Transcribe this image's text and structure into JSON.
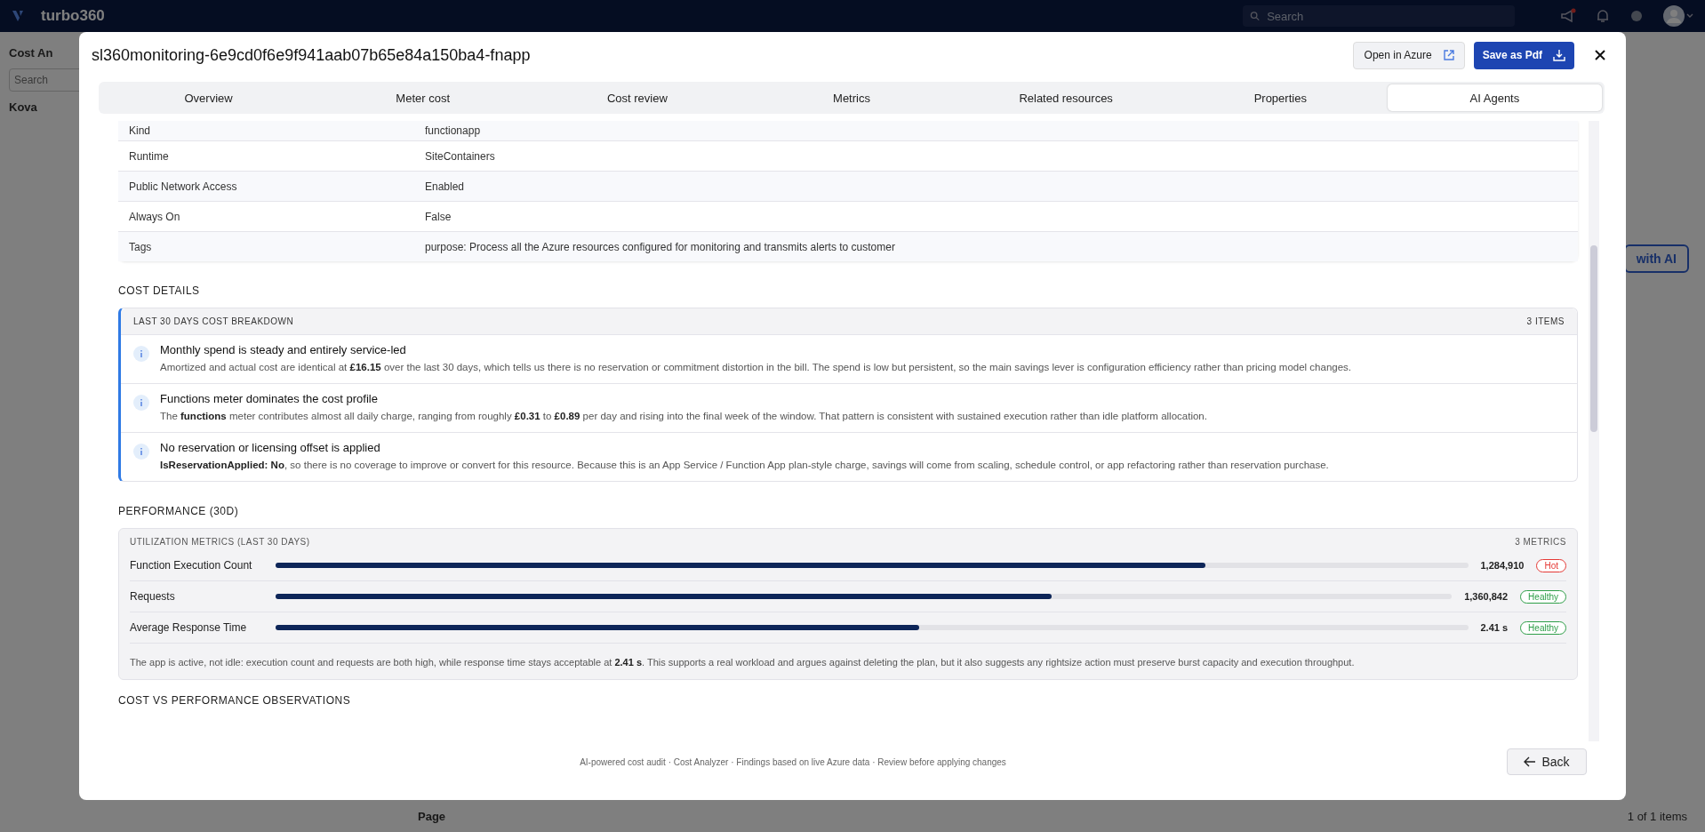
{
  "app": {
    "brand": "turbo360",
    "search": {
      "placeholder": "Search"
    },
    "page_title": "Cost An",
    "filter": {
      "placeholder": "Search"
    },
    "tree_item": "Kova",
    "ai_button": "with AI",
    "pager_label": "Page",
    "pager_count": "1 of 1 items"
  },
  "dialog": {
    "title": "sl360monitoring-6e9cd0f6e9f941aab07b65e84a150ba4-fnapp",
    "open_button": "Open in Azure",
    "pdf_button": "Save as Pdf",
    "tabs": [
      {
        "label": "Overview",
        "selected": false
      },
      {
        "label": "Meter cost",
        "selected": false
      },
      {
        "label": "Cost review",
        "selected": false
      },
      {
        "label": "Metrics",
        "selected": false
      },
      {
        "label": "Related resources",
        "selected": false
      },
      {
        "label": "Properties",
        "selected": false
      },
      {
        "label": "AI Agents",
        "selected": true
      }
    ],
    "properties": [
      {
        "name": "Kind",
        "value": "functionapp"
      },
      {
        "name": "Runtime",
        "value": "SiteContainers"
      },
      {
        "name": "Public Network Access",
        "value": "Enabled"
      },
      {
        "name": "Always On",
        "value": "False"
      },
      {
        "name": "Tags",
        "value": "purpose: Process all the Azure resources configured for monitoring and transmits alerts to customer"
      }
    ],
    "cost_details": {
      "heading": "COST DETAILS",
      "card_title": "LAST 30 DAYS COST BREAKDOWN",
      "count": "3 ITEMS",
      "items": [
        {
          "title": "Monthly spend is steady and entirely service-led",
          "text": "Amortized and actual cost are identical at **£16.15** over the last 30 days, which tells us there is no reservation or commitment distortion in the bill. The spend is low but persistent, so the main savings lever is configuration efficiency rather than pricing model changes."
        },
        {
          "title": "Functions meter dominates the cost profile",
          "text": "The **functions** meter contributes almost all daily charge, ranging from roughly **£0.31** to **£0.89** per day and rising into the final week of the window. That pattern is consistent with sustained execution rather than idle platform allocation."
        },
        {
          "title": "No reservation or licensing offset is applied",
          "text": "**IsReservationApplied: No**, so there is no coverage to improve or convert for this resource. Because this is an App Service / Function App plan-style charge, savings will come from scaling, schedule control, or app refactoring rather than reservation purchase."
        }
      ]
    },
    "performance": {
      "heading": "PERFORMANCE (30D)",
      "card_title": "UTILIZATION METRICS (LAST 30 DAYS)",
      "count": "3 METRICS",
      "metrics": [
        {
          "name": "Function Execution Count",
          "level": 0.78,
          "reading": "1,284,910",
          "badge": "Hot",
          "color": "#e53935"
        },
        {
          "name": "Requests",
          "level": 0.66,
          "reading": "1,360,842",
          "badge": "Healthy",
          "color": "#2e9e48"
        },
        {
          "name": "Average Response Time",
          "level": 0.54,
          "reading": "2.41 s",
          "badge": "Healthy",
          "color": "#2e9e48"
        }
      ],
      "summary": "The app is active, not idle: execution count and requests are both high, while response time stays acceptable at **2.41 s**. This supports a real workload and argues against deleting the plan, but it also suggests any rightsize action must preserve burst capacity and execution throughput."
    },
    "next_heading": "COST VS PERFORMANCE OBSERVATIONS",
    "footer": "AI-powered cost audit · Cost Analyzer · Findings based on live Azure data · Review before applying changes",
    "back_button": "Back"
  }
}
